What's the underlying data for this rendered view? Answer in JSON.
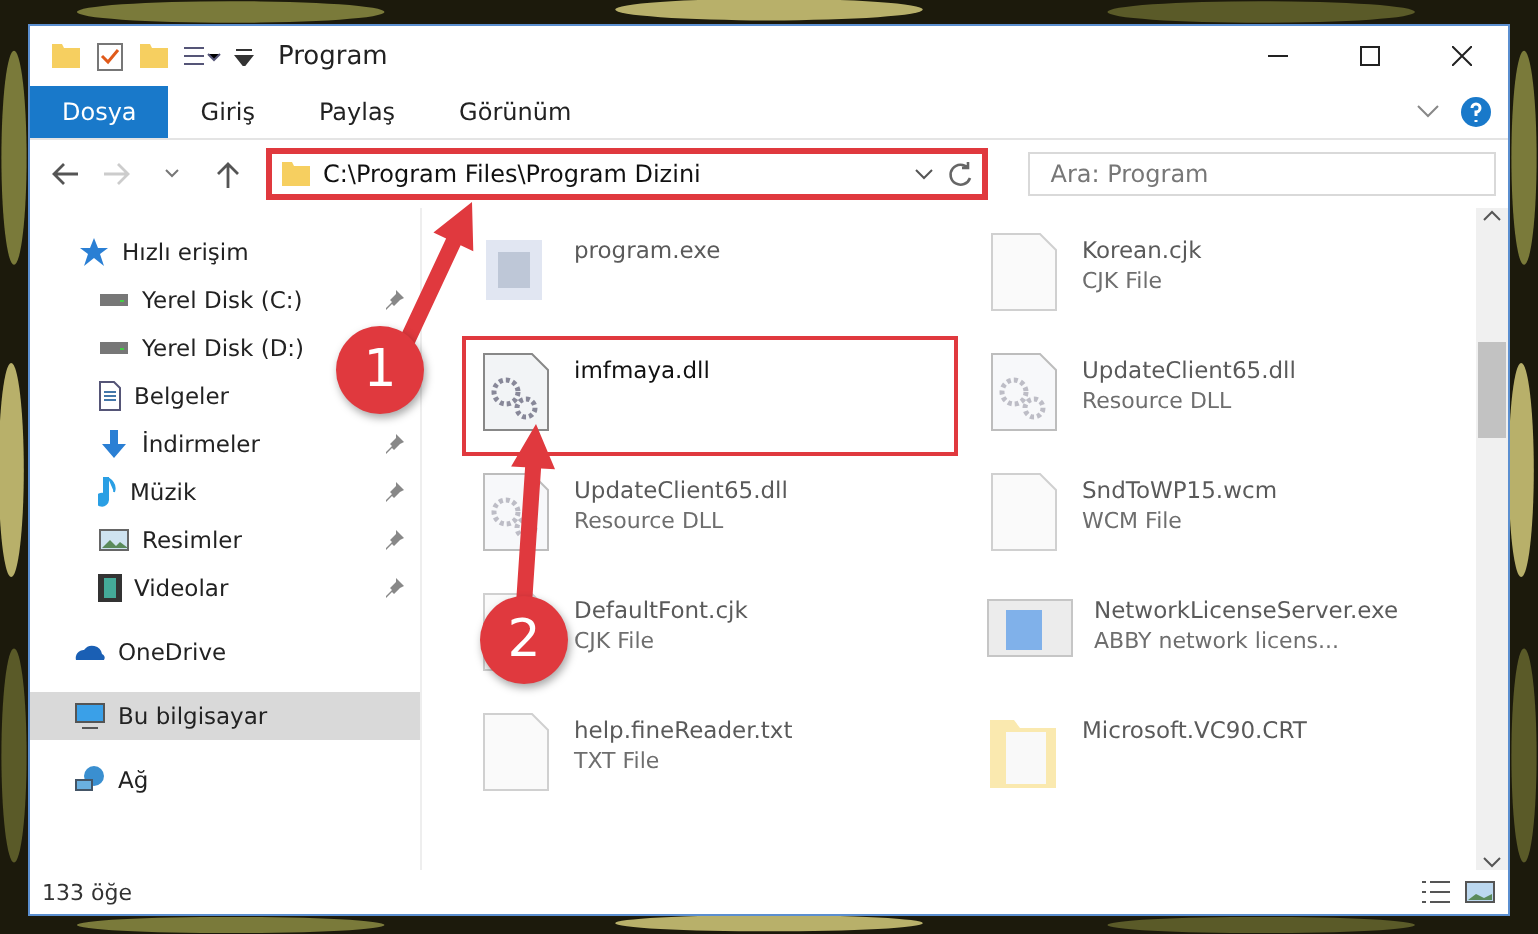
{
  "window": {
    "title": "Program"
  },
  "ribbon_tabs": [
    {
      "label": "Dosya",
      "selected": true
    },
    {
      "label": "Giriş",
      "selected": false
    },
    {
      "label": "Paylaş",
      "selected": false
    },
    {
      "label": "Görünüm",
      "selected": false
    }
  ],
  "address": {
    "path": "C:\\Program Files\\Program Dizini",
    "highlighted": true
  },
  "search": {
    "placeholder": "Ara: Program"
  },
  "sidebar": {
    "items": [
      {
        "label": "Hızlı erişim",
        "kind": "star",
        "selected": false,
        "children": [
          {
            "label": "Yerel Disk (C:)",
            "kind": "drive",
            "pinned": true,
            "selected": false
          },
          {
            "label": "Yerel Disk (D:)",
            "kind": "drive",
            "pinned": false,
            "selected": false
          },
          {
            "label": "Belgeler",
            "kind": "docs",
            "pinned": false,
            "selected": false
          },
          {
            "label": "İndirmeler",
            "kind": "download",
            "pinned": true,
            "selected": false
          },
          {
            "label": "Müzik",
            "kind": "music",
            "pinned": true,
            "selected": false
          },
          {
            "label": "Resimler",
            "kind": "pictures",
            "pinned": true,
            "selected": false
          },
          {
            "label": "Videolar",
            "kind": "video",
            "pinned": true,
            "selected": false
          }
        ]
      },
      {
        "label": "OneDrive",
        "kind": "cloud",
        "selected": false
      },
      {
        "label": "Bu bilgisayar",
        "kind": "pc",
        "selected": true
      },
      {
        "label": "Ağ",
        "kind": "network",
        "selected": false
      }
    ]
  },
  "files": [
    {
      "name": "program.exe",
      "kind": "exe",
      "blurred": true,
      "highlighted": false
    },
    {
      "name": "Korean.cjk",
      "type": "CJK File",
      "kind": "file",
      "blurred": true,
      "highlighted": false
    },
    {
      "name": "imfmaya.dll",
      "kind": "dll",
      "blurred": false,
      "highlighted": true
    },
    {
      "name": "UpdateClient65.dll",
      "type": "Resource DLL",
      "kind": "dll",
      "blurred": true,
      "highlighted": false
    },
    {
      "name": "UpdateClient65.dll",
      "type": "Resource DLL",
      "kind": "dll",
      "blurred": true,
      "highlighted": false
    },
    {
      "name": "SndToWP15.wcm",
      "type": "WCM File",
      "kind": "file",
      "blurred": true,
      "highlighted": false
    },
    {
      "name": "DefaultFont.cjk",
      "type": "CJK File",
      "kind": "file",
      "blurred": true,
      "highlighted": false
    },
    {
      "name": "NetworkLicenseServer.exe",
      "type": "ABBY network licens...",
      "kind": "app",
      "blurred": true,
      "highlighted": false
    },
    {
      "name": "help.fineReader.txt",
      "type": "TXT File",
      "kind": "file",
      "blurred": true,
      "highlighted": false
    },
    {
      "name": "Microsoft.VC90.CRT",
      "kind": "folder",
      "blurred": true,
      "highlighted": false
    }
  ],
  "annotations": [
    {
      "label": "1"
    },
    {
      "label": "2"
    }
  ],
  "status_bar": {
    "count": "133 öğe"
  }
}
